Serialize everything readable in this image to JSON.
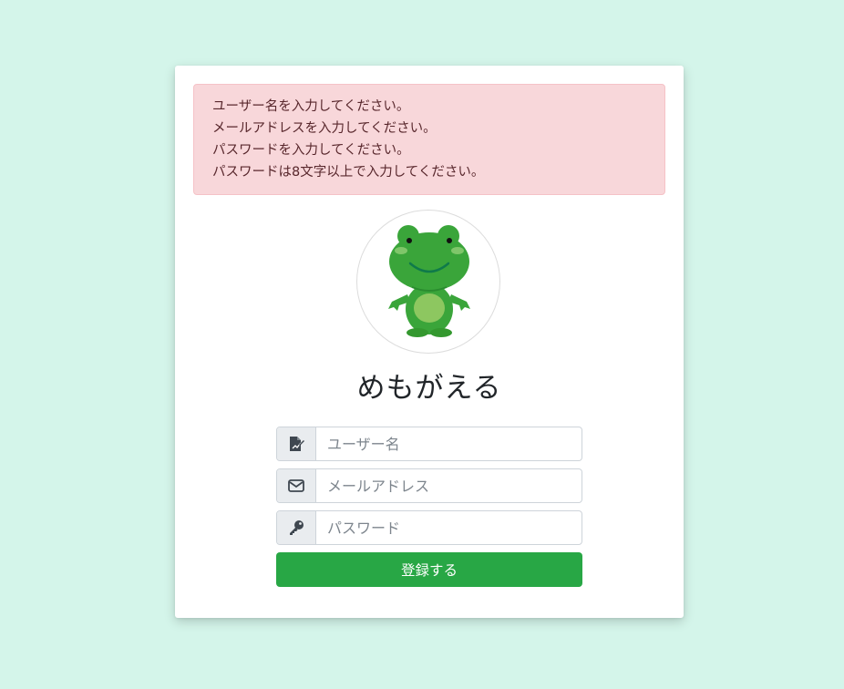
{
  "errors": [
    "ユーザー名を入力してください。",
    "メールアドレスを入力してください。",
    "パスワードを入力してください。",
    "パスワードは8文字以上で入力してください。"
  ],
  "app": {
    "title": "めもがえる",
    "logo": "frog-character"
  },
  "form": {
    "username": {
      "value": "",
      "placeholder": "ユーザー名",
      "icon": "signature-icon"
    },
    "email": {
      "value": "",
      "placeholder": "メールアドレス",
      "icon": "envelope-icon"
    },
    "password": {
      "value": "",
      "placeholder": "パスワード",
      "icon": "key-icon"
    },
    "submit_label": "登録する"
  },
  "colors": {
    "background": "#d4f5ea",
    "alert_bg": "#f8d7da",
    "alert_text": "#58272c",
    "submit": "#28a745",
    "frog_green": "#3aa53a"
  }
}
